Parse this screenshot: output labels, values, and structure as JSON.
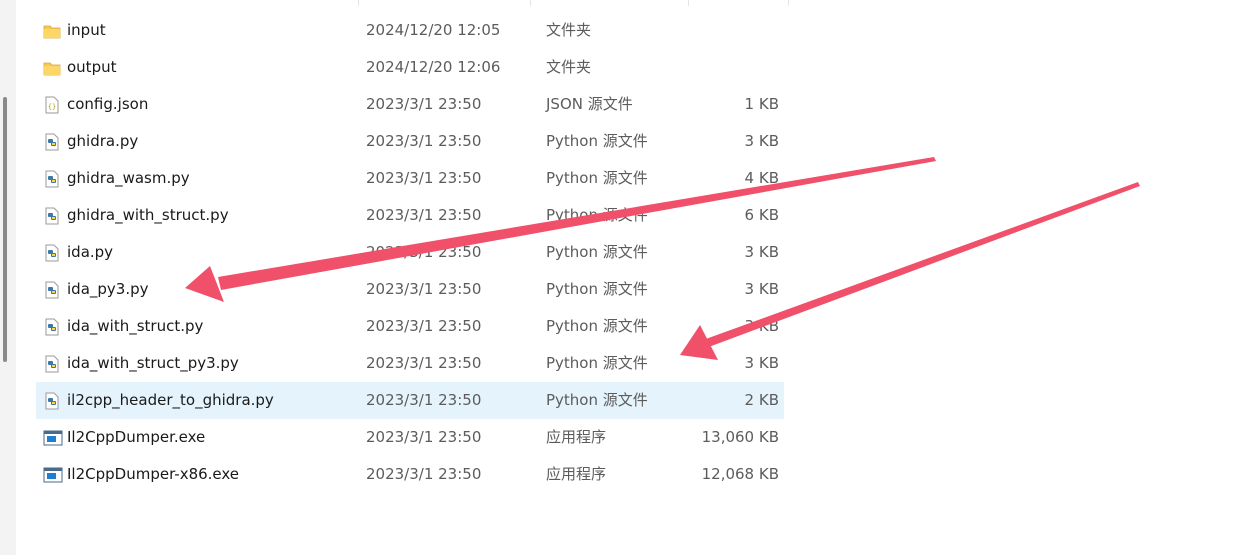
{
  "files": [
    {
      "name": "input",
      "date": "2024/12/20 12:05",
      "type": "文件夹",
      "size": "",
      "icon": "folder-icon",
      "selected": false
    },
    {
      "name": "output",
      "date": "2024/12/20 12:06",
      "type": "文件夹",
      "size": "",
      "icon": "folder-icon",
      "selected": false
    },
    {
      "name": "config.json",
      "date": "2023/3/1 23:50",
      "type": "JSON 源文件",
      "size": "1 KB",
      "icon": "json-file-icon",
      "selected": false
    },
    {
      "name": "ghidra.py",
      "date": "2023/3/1 23:50",
      "type": "Python 源文件",
      "size": "3 KB",
      "icon": "python-file-icon",
      "selected": false
    },
    {
      "name": "ghidra_wasm.py",
      "date": "2023/3/1 23:50",
      "type": "Python 源文件",
      "size": "4 KB",
      "icon": "python-file-icon",
      "selected": false
    },
    {
      "name": "ghidra_with_struct.py",
      "date": "2023/3/1 23:50",
      "type": "Python 源文件",
      "size": "6 KB",
      "icon": "python-file-icon",
      "selected": false
    },
    {
      "name": "ida.py",
      "date": "2023/3/1 23:50",
      "type": "Python 源文件",
      "size": "3 KB",
      "icon": "python-file-icon",
      "selected": false
    },
    {
      "name": "ida_py3.py",
      "date": "2023/3/1 23:50",
      "type": "Python 源文件",
      "size": "3 KB",
      "icon": "python-file-icon",
      "selected": false
    },
    {
      "name": "ida_with_struct.py",
      "date": "2023/3/1 23:50",
      "type": "Python 源文件",
      "size": "3 KB",
      "icon": "python-file-icon",
      "selected": false
    },
    {
      "name": "ida_with_struct_py3.py",
      "date": "2023/3/1 23:50",
      "type": "Python 源文件",
      "size": "3 KB",
      "icon": "python-file-icon",
      "selected": false
    },
    {
      "name": "il2cpp_header_to_ghidra.py",
      "date": "2023/3/1 23:50",
      "type": "Python 源文件",
      "size": "2 KB",
      "icon": "python-file-icon",
      "selected": true
    },
    {
      "name": "Il2CppDumper.exe",
      "date": "2023/3/1 23:50",
      "type": "应用程序",
      "size": "13,060 KB",
      "icon": "exe-file-icon",
      "selected": false
    },
    {
      "name": "Il2CppDumper-x86.exe",
      "date": "2023/3/1 23:50",
      "type": "应用程序",
      "size": "12,068 KB",
      "icon": "exe-file-icon",
      "selected": false
    }
  ],
  "colors": {
    "selection": "#e5f3fd",
    "arrow": "#f0506a",
    "folder": "#f8c850",
    "python_blue": "#3c78aa"
  }
}
